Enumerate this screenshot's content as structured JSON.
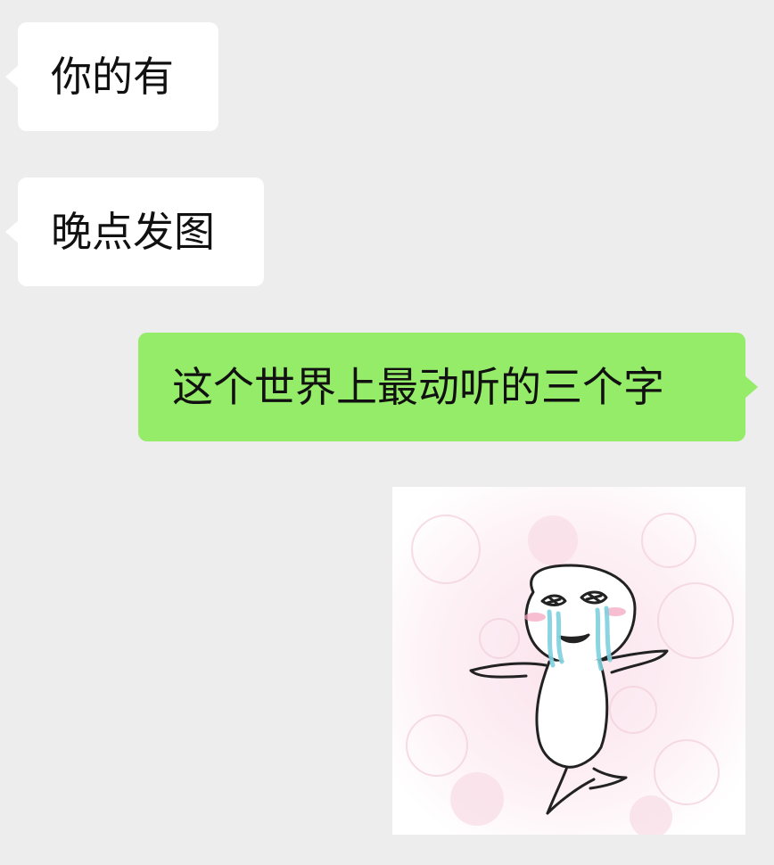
{
  "conversation": {
    "messages": [
      {
        "sender": "other",
        "type": "text",
        "text": "你的有"
      },
      {
        "sender": "other",
        "type": "text",
        "text": "晚点发图"
      },
      {
        "sender": "me",
        "type": "text",
        "text": "这个世界上最动听的三个字"
      },
      {
        "sender": "me",
        "type": "sticker",
        "sticker": "crying-dancing-meme-sticker"
      }
    ]
  },
  "colors": {
    "background": "#ededed",
    "incoming_bubble": "#ffffff",
    "outgoing_bubble": "#95ec69",
    "text": "#111111"
  }
}
